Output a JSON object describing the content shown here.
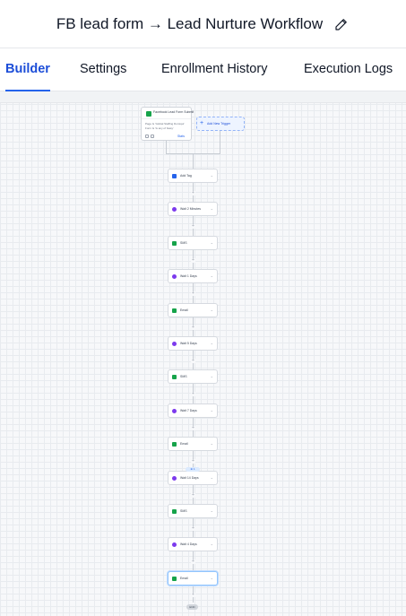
{
  "header": {
    "title": "FB lead form → Lead Nurture Workflow",
    "edit_icon": "pencil-icon"
  },
  "tabs": [
    {
      "label": "Builder",
      "active": true
    },
    {
      "label": "Settings",
      "active": false
    },
    {
      "label": "Enrollment History",
      "active": false
    },
    {
      "label": "Execution Logs",
      "active": false
    }
  ],
  "colors": {
    "accent": "#2563eb",
    "wait": "#7c3aed",
    "sms": "#16a34a",
    "tag": "#2563eb"
  },
  "trigger": {
    "title": "Facebook Lead Form Submit",
    "line1": "Page Is 'Global Staffing Domiqui'",
    "line2": "Form Is 'Is any of 'Easy'",
    "stats_label": "Stats"
  },
  "add_trigger": {
    "label": "Add New Trigger"
  },
  "actions": [
    {
      "label": "Add Tag",
      "kind": "tag"
    },
    {
      "label": "Wait 2 Minutes",
      "kind": "wait"
    },
    {
      "label": "SMS",
      "kind": "sms"
    },
    {
      "label": "Wait 1 Days",
      "kind": "wait"
    },
    {
      "label": "Email",
      "kind": "sms"
    },
    {
      "label": "Wait 5 Days",
      "kind": "wait"
    },
    {
      "label": "SMS",
      "kind": "sms"
    },
    {
      "label": "Wait 7 Days",
      "kind": "wait"
    },
    {
      "label": "Email",
      "kind": "sms"
    },
    {
      "label": "Wait 14 Days",
      "kind": "wait"
    },
    {
      "label": "SMS",
      "kind": "sms"
    },
    {
      "label": "Wait 4 Days",
      "kind": "wait"
    },
    {
      "label": "Email",
      "kind": "sms"
    }
  ],
  "badge": {
    "label": "⊕ 1"
  },
  "end": {
    "label": "END"
  }
}
